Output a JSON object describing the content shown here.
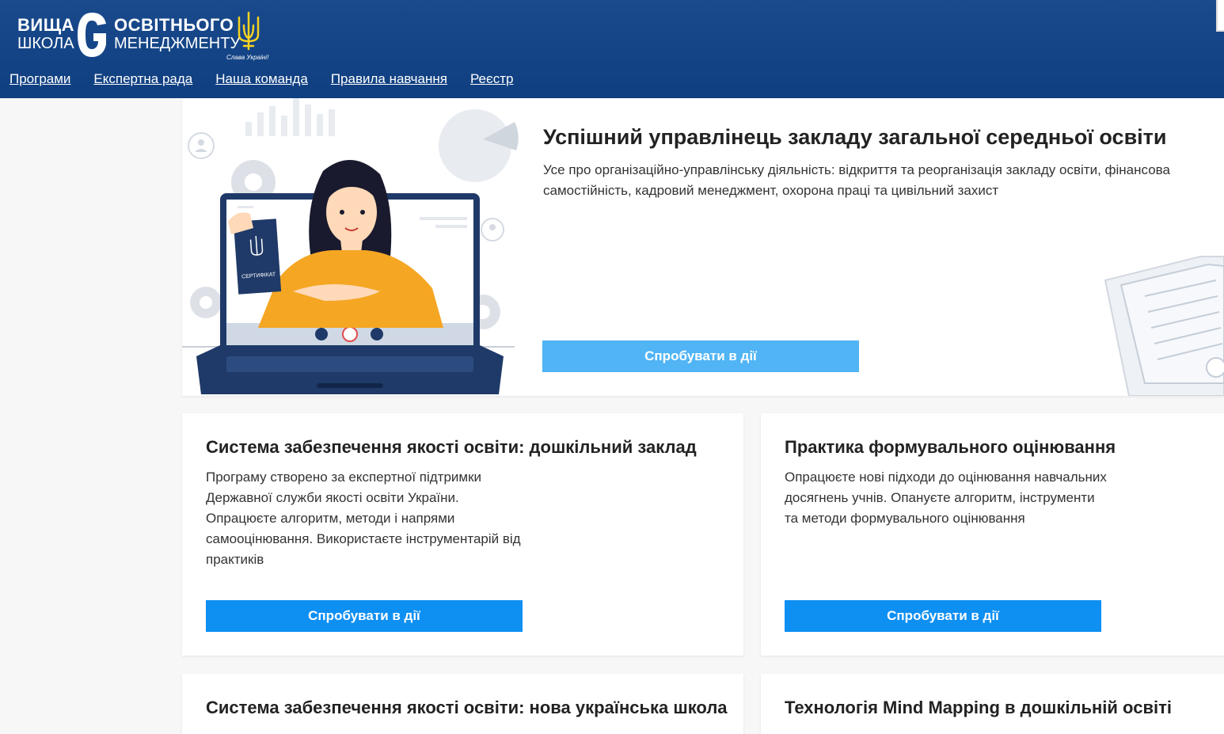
{
  "logo": {
    "left_line1": "ВИЩА",
    "left_line2": "ШКОЛА",
    "right_line1": "ОСВІТНЬОГО",
    "right_line2": "МЕНЕДЖМЕНТУ",
    "slogan": "Слава Україні!"
  },
  "nav": {
    "items": [
      {
        "label": "Програми"
      },
      {
        "label": "Експертна рада"
      },
      {
        "label": "Наша команда"
      },
      {
        "label": "Правила навчання"
      },
      {
        "label": "Реєстр"
      }
    ]
  },
  "hero": {
    "title": "Успішний управлінець закладу загальної середньої освіти",
    "description": "Усе про організаційно-управлінську діяльність: відкриття та реорганізація закладу освіти, фінансова самостійність, кадровий менеджмент, охорона праці та цивільний захист",
    "button_label": "Спробувати в дії",
    "certificate_label": "СЕРТИФІКАТ"
  },
  "cards": [
    {
      "title": "Система забезпечення якості освіти: дошкільний заклад",
      "description": "Програму створено за експертної підтримки Державної служби якості освіти України. Опрацюєте алгоритм, методи і напрями самооцінювання. Використаєте інструментарій від практиків",
      "button_label": "Спробувати в дії"
    },
    {
      "title": "Практика формувального оцінювання",
      "description": "Опрацюєте нові підходи до оцінювання навчальних досягнень учнів. Опануєте алгоритм, інструменти та методи формувального оцінювання",
      "button_label": "Спробувати в дії"
    },
    {
      "title": "Система забезпечення якості освіти: нова українська школа",
      "description": "",
      "button_label": ""
    },
    {
      "title": "Технологія Mind Mapping в дошкільній освіті",
      "description": "",
      "button_label": ""
    }
  ],
  "colors": {
    "header_bg": "#0f3f80",
    "hero_button": "#50b4f5",
    "card_button": "#0e8ff2",
    "illustration_orange": "#f5a623",
    "laptop_navy": "#1f3a68"
  }
}
